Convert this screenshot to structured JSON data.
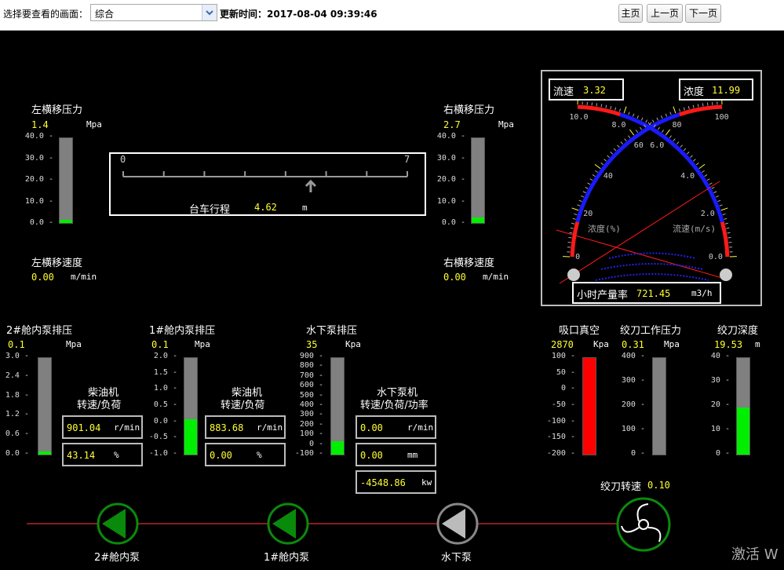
{
  "topbar": {
    "select_label": "选择要查看的画面：",
    "selected_view": "综合",
    "update_label": "更新时间：2017-08-04 09:39:46",
    "nav": {
      "home": "主页",
      "prev": "上一页",
      "next": "下一页"
    }
  },
  "left_traverse_pressure": {
    "title": "左横移压力",
    "value": "1.4",
    "unit": "Mpa",
    "ticks": [
      "40.0",
      "30.0",
      "20.0",
      "10.0",
      "0.0"
    ],
    "level": 0.035
  },
  "right_traverse_pressure": {
    "title": "右横移压力",
    "value": "2.7",
    "unit": "Mpa",
    "ticks": [
      "40.0",
      "30.0",
      "20.0",
      "10.0",
      "0.0"
    ],
    "level": 0.068
  },
  "left_traverse_speed": {
    "title": "左横移速度",
    "value": "0.00",
    "unit": "m/min"
  },
  "right_traverse_speed": {
    "title": "右横移速度",
    "value": "0.00",
    "unit": "m/min"
  },
  "trolley_travel": {
    "label": "台车行程",
    "value": "4.62",
    "unit": "m",
    "min": "0",
    "max": "7",
    "position": 4.62
  },
  "gauge": {
    "flow_label": "流速",
    "flow_value": "3.32",
    "conc_label": "浓度",
    "conc_value": "11.99",
    "conc_axis": "浓度(%)",
    "flow_axis": "流速(m/s)",
    "conc_ticks": [
      "0",
      "20",
      "40",
      "60",
      "80",
      "100"
    ],
    "flow_ticks": [
      "0.0",
      "2.0",
      "4.0",
      "6.0",
      "8.0",
      "10.0"
    ],
    "production_label": "小时产量率",
    "production_value": "721.45",
    "production_unit": "m3/h"
  },
  "pump2_discharge": {
    "title": "2#舱内泵排压",
    "value": "0.1",
    "unit": "Mpa",
    "ticks": [
      "3.0",
      "2.4",
      "1.8",
      "1.2",
      "0.6",
      "0.0"
    ],
    "level": 0.033
  },
  "pump1_discharge": {
    "title": "1#舱内泵排压",
    "value": "0.1",
    "unit": "Mpa",
    "ticks": [
      "2.0",
      "1.5",
      "1.0",
      "0.5",
      "0.0",
      "-0.5",
      "-1.0"
    ],
    "level": 0.367
  },
  "underwater_discharge": {
    "title": "水下泵排压",
    "value": "35",
    "unit": "Kpa",
    "ticks": [
      "900",
      "800",
      "700",
      "600",
      "500",
      "400",
      "300",
      "200",
      "100",
      "0",
      "-100"
    ],
    "level": 0.135
  },
  "diesel2": {
    "title1": "柴油机",
    "title2": "转速/负荷",
    "rpm": "901.04",
    "rpm_unit": "r/min",
    "load": "43.14",
    "load_unit": "%"
  },
  "diesel1": {
    "title1": "柴油机",
    "title2": "转速/负荷",
    "rpm": "883.68",
    "rpm_unit": "r/min",
    "load": "0.00",
    "load_unit": "%"
  },
  "underwater_pump": {
    "title1": "水下泵机",
    "title2": "转速/负荷/功率",
    "rpm": "0.00",
    "rpm_unit": "r/min",
    "load": "0.00",
    "load_unit": "mm",
    "power": "-4548.86",
    "power_unit": "kw"
  },
  "suction_vacuum": {
    "title": "吸口真空",
    "value": "2870",
    "unit": "Kpa",
    "ticks": [
      "100",
      "50",
      "0",
      "-50",
      "-100",
      "-150",
      "-200"
    ],
    "level": 1.0
  },
  "cutter_pressure": {
    "title": "绞刀工作压力",
    "value": "0.31",
    "unit": "Mpa",
    "ticks": [
      "400",
      "300",
      "200",
      "100",
      "0"
    ],
    "level": 0.001
  },
  "cutter_depth": {
    "title": "绞刀深度",
    "value": "19.53",
    "unit": "m",
    "ticks": [
      "40",
      "30",
      "20",
      "10",
      "0"
    ],
    "level": 0.488
  },
  "cutter_speed": {
    "label": "绞刀转速",
    "value": "0.10"
  },
  "pumps": {
    "p2": "2#舱内泵",
    "p1": "1#舱内泵",
    "uw": "水下泵"
  },
  "watermark": "激活 W",
  "colors": {
    "fill_green": "#00ee00",
    "fill_red": "#ff0000",
    "pump_green": "#0a8a0a",
    "pump_gray": "#888888",
    "pipe": "#8b1a1a"
  }
}
